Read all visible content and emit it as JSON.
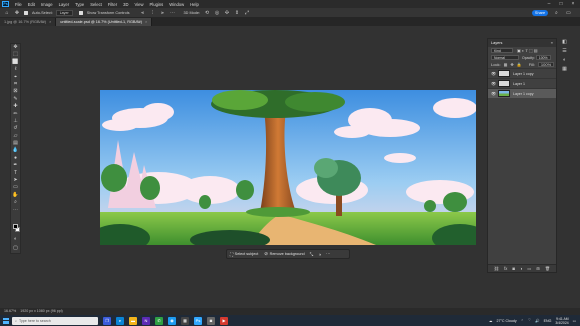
{
  "menubar": {
    "logo": "Ps",
    "items": [
      "File",
      "Edit",
      "Image",
      "Layer",
      "Type",
      "Select",
      "Filter",
      "3D",
      "View",
      "Plugins",
      "Window",
      "Help"
    ]
  },
  "options": {
    "auto_select_label": "Auto-Select:",
    "auto_select_value": "Layer",
    "transform_controls_label": "Show Transform Controls",
    "mode_3d_label": "3D Mode:",
    "share_label": "Share"
  },
  "tabs": [
    {
      "label": "1.jpg @ 16.7% (RGB/8#)",
      "active": false
    },
    {
      "label": "untitled-scale.psd @ 16.7% (Untitled-1, RGB/8#)",
      "active": true
    }
  ],
  "context_bar": {
    "select_subject": "Select subject",
    "remove_background": "Remove background"
  },
  "layers_panel": {
    "title": "Layers",
    "search_placeholder": "Kind",
    "blend_mode": "Normal",
    "opacity_label": "Opacity:",
    "opacity_value": "100%",
    "lock_label": "Lock:",
    "fill_label": "Fill:",
    "fill_value": "100%",
    "layers": [
      {
        "name": "Layer 1 copy",
        "selected": false
      },
      {
        "name": "Layer 1",
        "selected": false
      },
      {
        "name": "Layer 1 copy",
        "selected": true
      }
    ]
  },
  "status": {
    "zoom": "16.67%",
    "doc_size": "1920 px x 1080 px (96 ppi)"
  },
  "taskbar": {
    "search_placeholder": "Type here to search",
    "weather": "27°C Cloudy",
    "language": "ENG",
    "time": "9:41 AM",
    "date": "3/4/2024"
  },
  "colors": {
    "accent": "#1473e6",
    "app_bg": "#323232",
    "panel_bg": "#404040",
    "taskbar_bg": "#1f2a38"
  }
}
